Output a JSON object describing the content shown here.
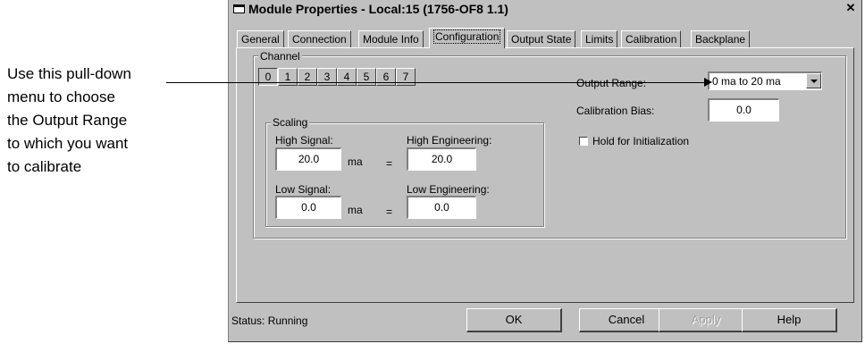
{
  "callout": {
    "lines": [
      "Use this pull-down",
      "menu to choose",
      "the Output Range",
      "to which you want",
      "to calibrate"
    ]
  },
  "window": {
    "title": "Module Properties - Local:15 (1756-OF8 1.1)",
    "close_glyph": "✕"
  },
  "tabs": [
    "General",
    "Connection",
    "Module Info",
    "Configuration",
    "Output State",
    "Limits",
    "Calibration",
    "Backplane"
  ],
  "active_tab": "Configuration",
  "channel": {
    "group_label": "Channel",
    "buttons": [
      "0",
      "1",
      "2",
      "3",
      "4",
      "5",
      "6",
      "7"
    ],
    "selected": "0"
  },
  "scaling": {
    "group_label": "Scaling",
    "high_signal_label": "High Signal:",
    "high_signal_value": "20.0",
    "high_signal_unit": "ma",
    "high_eng_label": "High Engineering:",
    "high_eng_value": "20.0",
    "low_signal_label": "Low Signal:",
    "low_signal_value": "0.0",
    "low_signal_unit": "ma",
    "low_eng_label": "Low Engineering:",
    "low_eng_value": "0.0",
    "equals": "="
  },
  "output_range": {
    "label": "Output Range:",
    "value": "0 ma to 20 ma"
  },
  "calibration_bias": {
    "label": "Calibration Bias:",
    "value": "0.0"
  },
  "hold_init": {
    "label": "Hold for Initialization",
    "checked": false
  },
  "status": {
    "text": "Status:  Running"
  },
  "buttons": {
    "ok": "OK",
    "cancel": "Cancel",
    "apply": "Apply",
    "help": "Help"
  }
}
